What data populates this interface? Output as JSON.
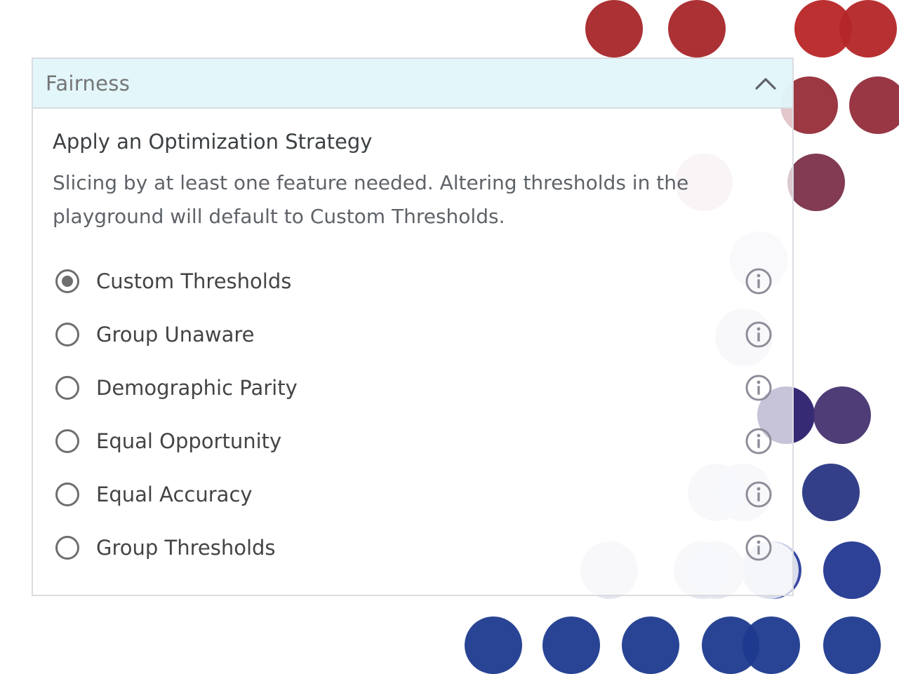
{
  "background": {
    "dots": [
      {
        "color": "#a62629"
      },
      {
        "color": "#a62629"
      },
      {
        "color": "#b82526"
      },
      {
        "color": "#b32627"
      },
      {
        "color": "#962d38"
      },
      {
        "color": "#932c3a"
      },
      {
        "color": "#e8d8de"
      },
      {
        "color": "#7b304a"
      },
      {
        "color": "#e9e3ea"
      },
      {
        "color": "#e6e0ea"
      },
      {
        "color": "#2b1f6e"
      },
      {
        "color": "#463370"
      },
      {
        "color": "#e3e4ef"
      },
      {
        "color": "#e3e4ef"
      },
      {
        "color": "#283683"
      },
      {
        "color": "#e3e6f0"
      },
      {
        "color": "#e3e6f0"
      },
      {
        "color": "#e3e6f0"
      },
      {
        "color": "#2a3d9c"
      },
      {
        "color": "#e3e6f0"
      },
      {
        "color": "#223791"
      },
      {
        "color": "#1e3a8e"
      },
      {
        "color": "#1e3a8e"
      },
      {
        "color": "#1e3a8e"
      },
      {
        "color": "#1e3a8e"
      },
      {
        "color": "#1e3a8e"
      },
      {
        "color": "#1e3a8e"
      }
    ]
  },
  "panel": {
    "title": "Fairness",
    "section_title": "Apply an Optimization Strategy",
    "description": "Slicing by at least one feature needed. Altering thresholds in the playground will default to Custom Thresholds.",
    "options": [
      {
        "label": "Custom Thresholds",
        "selected": true
      },
      {
        "label": "Group Unaware",
        "selected": false
      },
      {
        "label": "Demographic Parity",
        "selected": false
      },
      {
        "label": "Equal Opportunity",
        "selected": false
      },
      {
        "label": "Equal Accuracy",
        "selected": false
      },
      {
        "label": "Group Thresholds",
        "selected": false
      }
    ]
  },
  "colors": {
    "header_bg": "#e1f5fa",
    "border": "#dadce0",
    "radio": "#6e6e6e",
    "info_icon": "#8e8e9a"
  },
  "icons": {
    "collapse": "chevron-up-icon",
    "info": "info-icon"
  }
}
